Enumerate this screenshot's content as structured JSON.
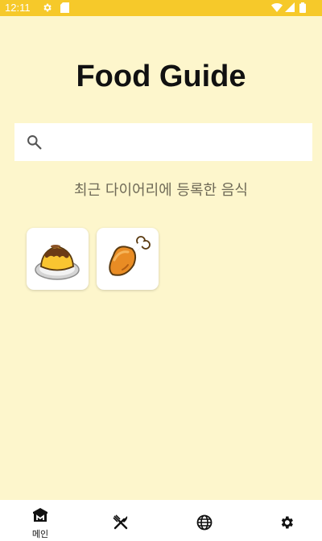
{
  "status_bar": {
    "time": "12:11",
    "left_icons": [
      "gear-icon",
      "sd-card-icon"
    ],
    "right_icons": [
      "wifi-icon",
      "signal-icon",
      "battery-icon"
    ],
    "color": "#f6c92a"
  },
  "header": {
    "title": "Food Guide"
  },
  "search": {
    "value": "",
    "placeholder": ""
  },
  "recent": {
    "subtitle": "최근 다이어리에 등록한 음식",
    "items": [
      {
        "icon": "pudding-icon"
      },
      {
        "icon": "chicken-leg-icon"
      }
    ]
  },
  "bottom_nav": {
    "items": [
      {
        "icon": "home-icon",
        "label": "메인",
        "selected": true
      },
      {
        "icon": "fork-knife-icon",
        "label": ""
      },
      {
        "icon": "globe-icon",
        "label": ""
      },
      {
        "icon": "settings-icon",
        "label": ""
      }
    ]
  },
  "colors": {
    "background": "#fdf6cc",
    "accent": "#f6c92a"
  }
}
